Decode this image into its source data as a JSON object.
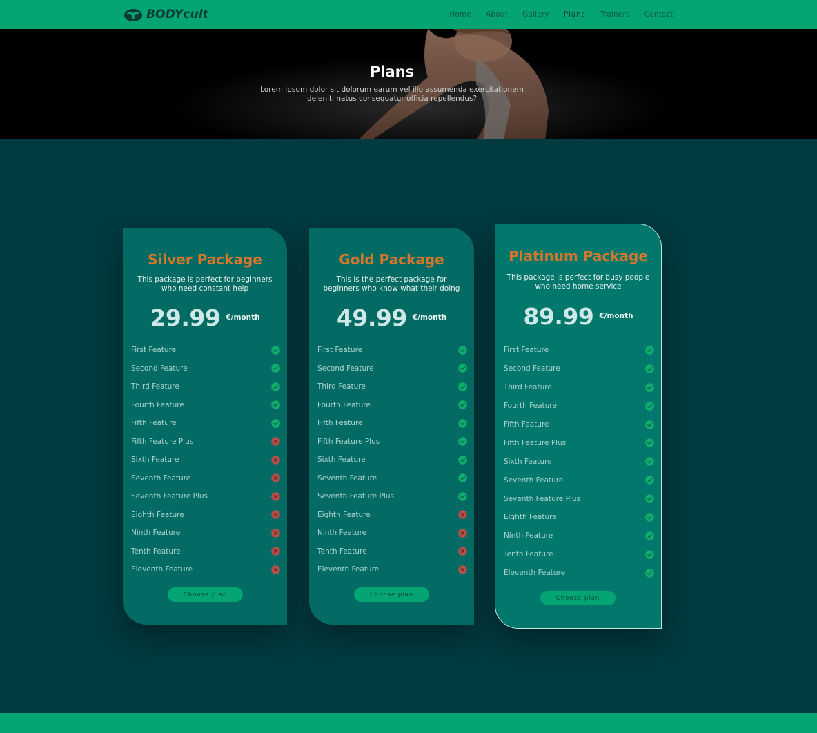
{
  "brand": {
    "name": "BODYcult"
  },
  "nav": {
    "items": [
      {
        "label": "Home",
        "active": false
      },
      {
        "label": "About",
        "active": false
      },
      {
        "label": "Gallery",
        "active": false
      },
      {
        "label": "Plans",
        "active": true
      },
      {
        "label": "Trainers",
        "active": false
      },
      {
        "label": "Contact",
        "active": false
      }
    ]
  },
  "hero": {
    "title": "Plans",
    "subtitle": "Lorem ipsum dolor sit dolorum earum vel illo assumenda exercitationem deleniti natus consequatur officia repellendus?"
  },
  "colors": {
    "accent_green": "#04a572",
    "page_bg": "#013a3f",
    "card_bg": "#036b63",
    "title_orange": "#d2772c",
    "check_green": "#0fae6f",
    "cross_red": "#b4504a"
  },
  "plans": [
    {
      "name": "Silver Package",
      "description": "This package is perfect for beginners who need constant help",
      "price": "29.99",
      "period": "€/month",
      "button_label": "Choose plan",
      "features": [
        {
          "label": "First Feature",
          "included": true
        },
        {
          "label": "Second Feature",
          "included": true
        },
        {
          "label": "Third Feature",
          "included": true
        },
        {
          "label": "Fourth Feature",
          "included": true
        },
        {
          "label": "Fifth Feature",
          "included": true
        },
        {
          "label": "Fifth Feature Plus",
          "included": false
        },
        {
          "label": "Sixth Feature",
          "included": false
        },
        {
          "label": "Seventh Feature",
          "included": false
        },
        {
          "label": "Seventh Feature Plus",
          "included": false
        },
        {
          "label": "Eighth Feature",
          "included": false
        },
        {
          "label": "Ninth Feature",
          "included": false
        },
        {
          "label": "Tenth Feature",
          "included": false
        },
        {
          "label": "Eleventh Feature",
          "included": false
        }
      ]
    },
    {
      "name": "Gold Package",
      "description": "This is the perfect package for beginners who know what their doing",
      "price": "49.99",
      "period": "€/month",
      "button_label": "Choose plan",
      "features": [
        {
          "label": "First Feature",
          "included": true
        },
        {
          "label": "Second Feature",
          "included": true
        },
        {
          "label": "Third Feature",
          "included": true
        },
        {
          "label": "Fourth Feature",
          "included": true
        },
        {
          "label": "Fifth Feature",
          "included": true
        },
        {
          "label": "Fifth Feature Plus",
          "included": true
        },
        {
          "label": "Sixth Feature",
          "included": true
        },
        {
          "label": "Seventh Feature",
          "included": true
        },
        {
          "label": "Seventh Feature Plus",
          "included": true
        },
        {
          "label": "Eighth Feature",
          "included": false
        },
        {
          "label": "Ninth Feature",
          "included": false
        },
        {
          "label": "Tenth Feature",
          "included": false
        },
        {
          "label": "Eleventh Feature",
          "included": false
        }
      ]
    },
    {
      "name": "Platinum Package",
      "description": "This package is perfect for busy people who need home service",
      "price": "89.99",
      "period": "€/month",
      "button_label": "Choose plan",
      "features": [
        {
          "label": "First Feature",
          "included": true
        },
        {
          "label": "Second Feature",
          "included": true
        },
        {
          "label": "Third Feature",
          "included": true
        },
        {
          "label": "Fourth Feature",
          "included": true
        },
        {
          "label": "Fifth Feature",
          "included": true
        },
        {
          "label": "Fifth Feature Plus",
          "included": true
        },
        {
          "label": "Sixth Feature",
          "included": true
        },
        {
          "label": "Seventh Feature",
          "included": true
        },
        {
          "label": "Seventh Feature Plus",
          "included": true
        },
        {
          "label": "Eighth Feature",
          "included": true
        },
        {
          "label": "Ninth Feature",
          "included": true
        },
        {
          "label": "Tenth Feature",
          "included": true
        },
        {
          "label": "Eleventh Feature",
          "included": true
        }
      ]
    }
  ]
}
